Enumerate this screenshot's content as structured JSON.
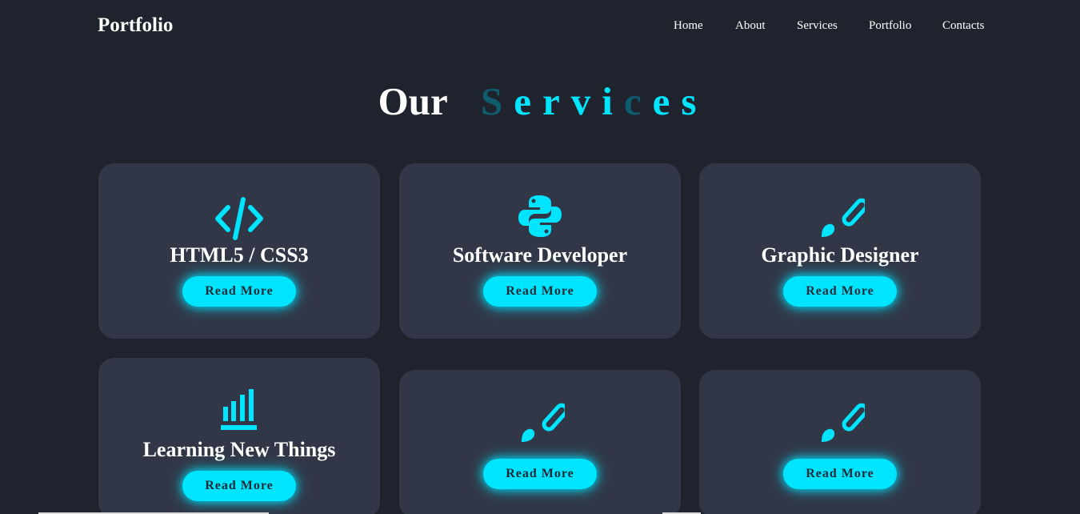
{
  "navbar": {
    "brand": "Portfolio",
    "links": [
      "Home",
      "About",
      "Services",
      "Portfolio",
      "Contacts"
    ]
  },
  "heading": {
    "main": "Our",
    "accent_letters": [
      "S",
      "e",
      "r",
      "v",
      "i",
      "c",
      "e",
      "s"
    ],
    "dim_letter_indexes": [
      0,
      5
    ]
  },
  "services": [
    {
      "icon": "code-icon",
      "title": "HTML5 / CSS3",
      "button": "Read More"
    },
    {
      "icon": "python-icon",
      "title": "Software Developer",
      "button": "Read More"
    },
    {
      "icon": "paintbrush-icon",
      "title": "Graphic Designer",
      "button": "Read More"
    },
    {
      "icon": "bar-chart-icon",
      "title": "Learning New Things",
      "button": "Read More"
    },
    {
      "icon": "paintbrush-icon",
      "title": "",
      "button": "Read More"
    },
    {
      "icon": "paintbrush-icon",
      "title": "",
      "button": "Read More"
    }
  ],
  "colors": {
    "background": "#1f232d",
    "card": "#313747",
    "accent": "#00e5ff",
    "accent_dim": "#0e5c6e"
  }
}
